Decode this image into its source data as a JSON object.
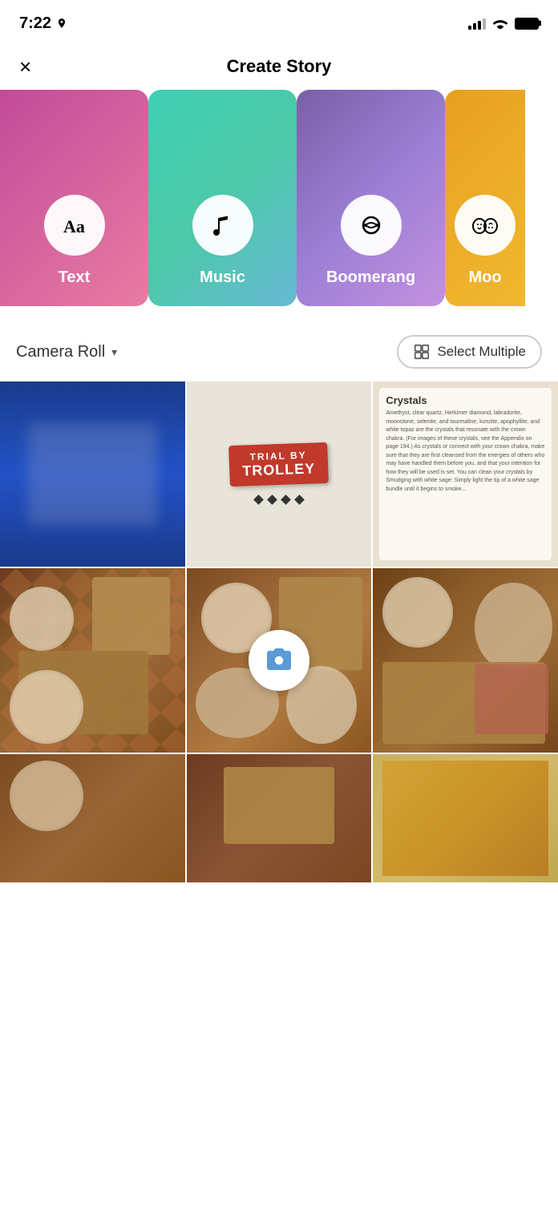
{
  "status": {
    "time": "7:22",
    "location_active": true
  },
  "header": {
    "title": "Create Story",
    "close_label": "×"
  },
  "story_cards": [
    {
      "id": "text",
      "label": "Text",
      "icon": "text-icon",
      "gradient": "card-text"
    },
    {
      "id": "music",
      "label": "Music",
      "icon": "music-icon",
      "gradient": "card-music"
    },
    {
      "id": "boomerang",
      "label": "Boomerang",
      "icon": "boomerang-icon",
      "gradient": "card-boomerang"
    },
    {
      "id": "moo",
      "label": "Moo",
      "icon": "moo-icon",
      "gradient": "card-moo"
    }
  ],
  "camera_roll": {
    "label": "Camera Roll",
    "chevron": "▾",
    "select_multiple": "Select Multiple"
  },
  "book": {
    "title": "Crystals",
    "text": "Amethyst, clear quartz, Herkimer diamond, labradorite, moonstone, selenite, and tourmaline, kunzite, apophyllite, and white topaz are the crystals that resonate with the crown chakra. (For images of these crystals, see the Appendix on page 194.) As crystals or connect with your crown chakra, make sure that they are first cleansed from the energies of others who may have handled them before you, and that your intention for how they will be used is set. You can clean your crystals by Smudging with white sage: Simply light the tip of a white sage bundle until it begins to smoke..."
  },
  "trolley": {
    "line1": "TRIAL BY",
    "line2": "TROLLEY"
  }
}
